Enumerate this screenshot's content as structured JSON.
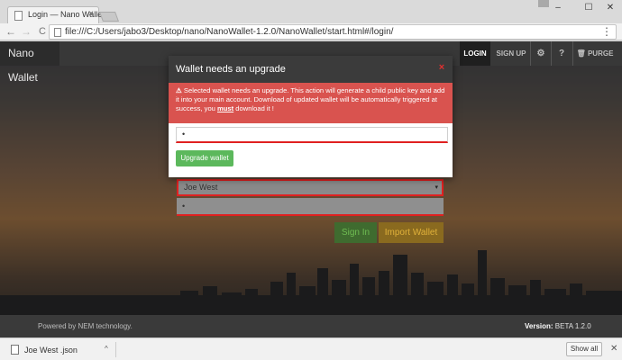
{
  "browser": {
    "tab_title": "Login — Nano Wallet",
    "tab_close": "×",
    "url": "file:///C:/Users/jabo3/Desktop/nano/NanoWallet-1.2.0/NanoWallet/start.html#/login/",
    "back": "←",
    "forward": "→",
    "reload": "C",
    "menu": "⋮",
    "win_min": "–",
    "win_max": "☐",
    "win_close": "✕"
  },
  "navbar": {
    "brand": "Nano Wallet",
    "login": "LOGIN",
    "signup": "SIGN UP",
    "settings_icon": "⚙",
    "help_icon": "?",
    "purge": "🗑 PURGE"
  },
  "login_form": {
    "wallet_selected": "Joe West",
    "caret": "▾",
    "password_value": "•",
    "signin_label": "Sign In",
    "import_label": "Import Wallet"
  },
  "modal": {
    "title": "Wallet needs an upgrade",
    "close": "×",
    "alert_icon": "⚠",
    "alert_text_before": " Selected wallet needs an upgrade. This action will generate a child public key and add it into your main account. Download of updated wallet will be automatically triggered at success, you ",
    "alert_emphasis": "must",
    "alert_text_after": " download it !",
    "password_value": "•",
    "upgrade_button": "Upgrade wallet"
  },
  "footer": {
    "powered": "Powered by NEM technology.",
    "version_label": "Version:",
    "version_value": " BETA 1.2.0"
  },
  "downloads": {
    "file_name": "Joe West .json",
    "caret": "^",
    "show_all": "Show all",
    "close": "✕"
  },
  "colors": {
    "alert_red": "#d9534f",
    "success_green": "#5cb85c",
    "highlight_red": "#e02020"
  }
}
